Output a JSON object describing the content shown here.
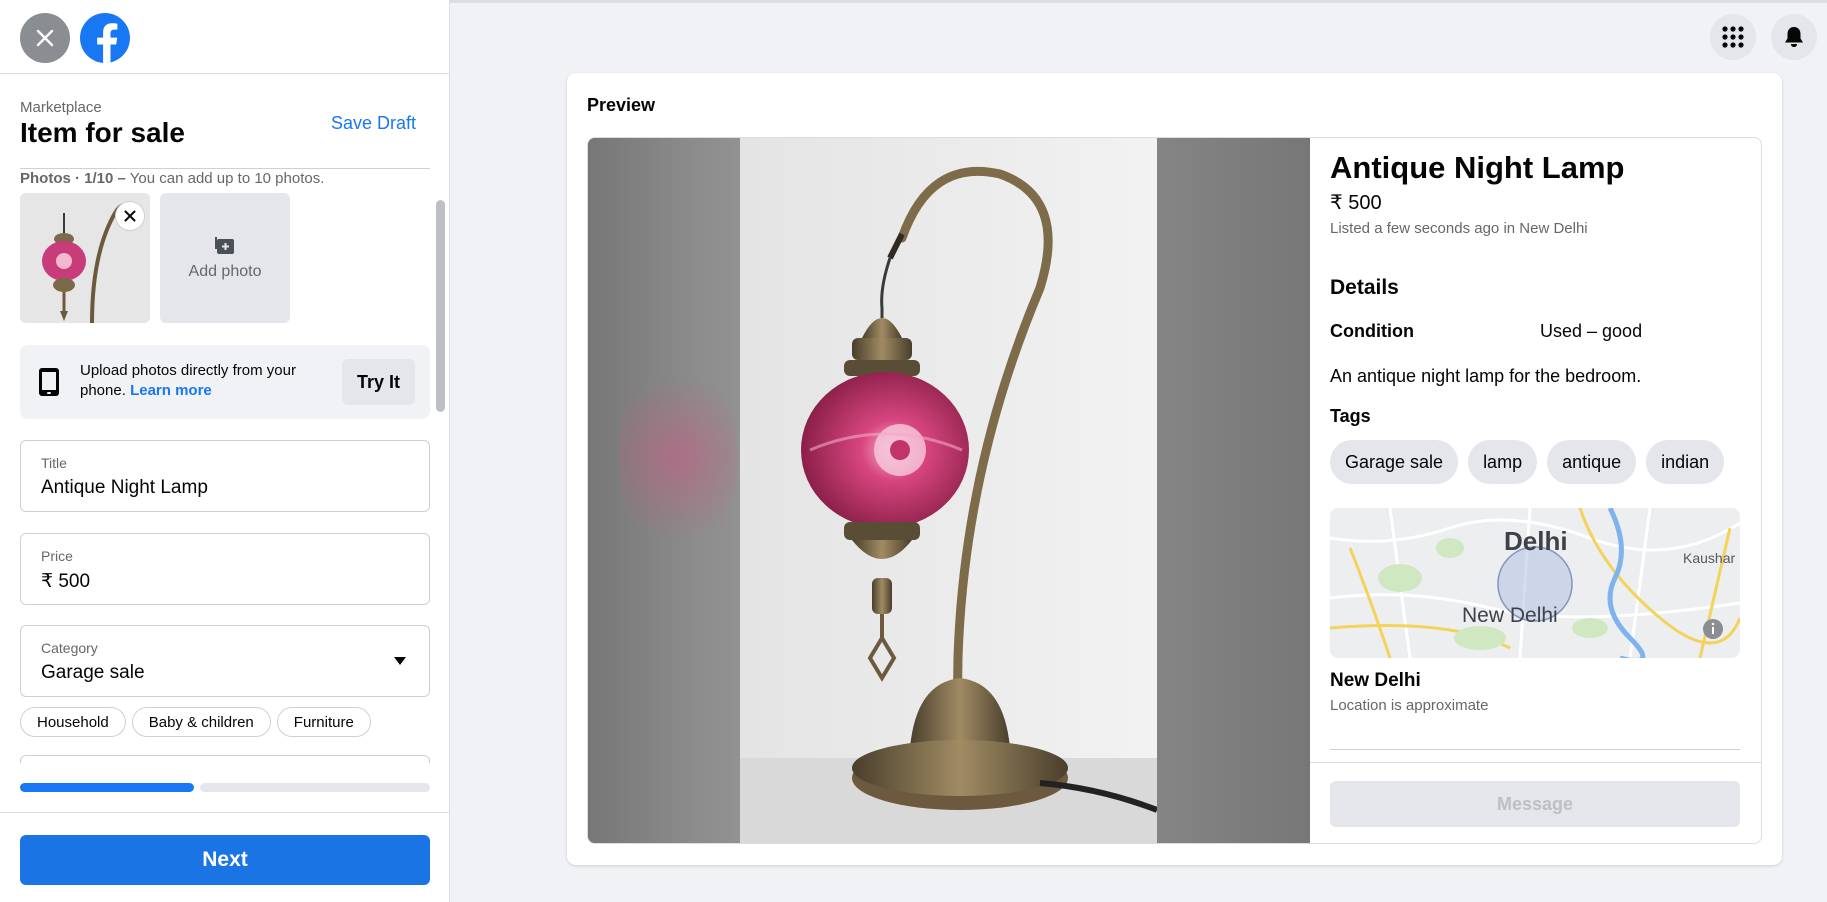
{
  "sidebar": {
    "breadcrumb": "Marketplace",
    "title": "Item for sale",
    "save_draft": "Save Draft",
    "photos_count": "Photos · 1/10 –",
    "photos_hint": " You can add up to 10 photos.",
    "add_photo": "Add photo",
    "upload_text": "Upload photos directly from your phone.",
    "learn_more": "Learn more",
    "try_it": "Try It",
    "title_field": {
      "label": "Title",
      "value": "Antique Night Lamp"
    },
    "price_field": {
      "label": "Price",
      "value": "₹ 500"
    },
    "category_field": {
      "label": "Category",
      "value": "Garage sale"
    },
    "suggested_categories": [
      "Household",
      "Baby & children",
      "Furniture"
    ],
    "progress": 0.5,
    "next": "Next"
  },
  "top_icons": [
    "menu-grid-icon",
    "notifications-bell-icon"
  ],
  "preview": {
    "label": "Preview",
    "item_title": "Antique Night Lamp",
    "price": "₹ 500",
    "listed": "Listed a few seconds ago in New Delhi",
    "details_heading": "Details",
    "condition_label": "Condition",
    "condition_value": "Used – good",
    "description": "An antique night lamp for the bedroom.",
    "tags_heading": "Tags",
    "tags": [
      "Garage sale",
      "lamp",
      "antique",
      "indian"
    ],
    "map_labels": {
      "city": "Delhi",
      "area": "New Delhi",
      "edge": "Kaushar"
    },
    "location_name": "New Delhi",
    "location_note": "Location is approximate",
    "message": "Message"
  },
  "colors": {
    "brand": "#1877f2",
    "button_blue": "#1b74e4",
    "muted_text": "#65676b",
    "chip_bg": "#e4e6eb"
  }
}
